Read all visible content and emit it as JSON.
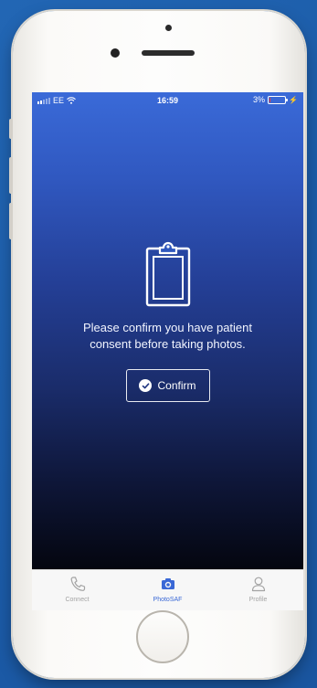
{
  "status_bar": {
    "carrier": "EE",
    "time": "16:59",
    "battery": "3%",
    "battery_level": 0.03,
    "icons": [
      "signal-icon",
      "wifi-icon",
      "battery-icon",
      "charging-icon"
    ]
  },
  "consent": {
    "icon": "clipboard-icon",
    "message": "Please confirm you have patient consent before taking photos.",
    "confirm_label": "Confirm",
    "confirm_icon": "check-circle-icon"
  },
  "tab_bar": {
    "tabs": [
      {
        "label": "Connect",
        "icon": "phone-icon",
        "active": false
      },
      {
        "label": "PhotoSAF",
        "icon": "camera-icon",
        "active": true
      },
      {
        "label": "Profile",
        "icon": "user-icon",
        "active": false
      }
    ]
  },
  "colors": {
    "background": "#1f5eaa",
    "gradient_top": "#3a6ad8",
    "gradient_bottom": "#04060f",
    "active_tab": "#3a68d6",
    "inactive_tab": "#a3a3a3"
  }
}
